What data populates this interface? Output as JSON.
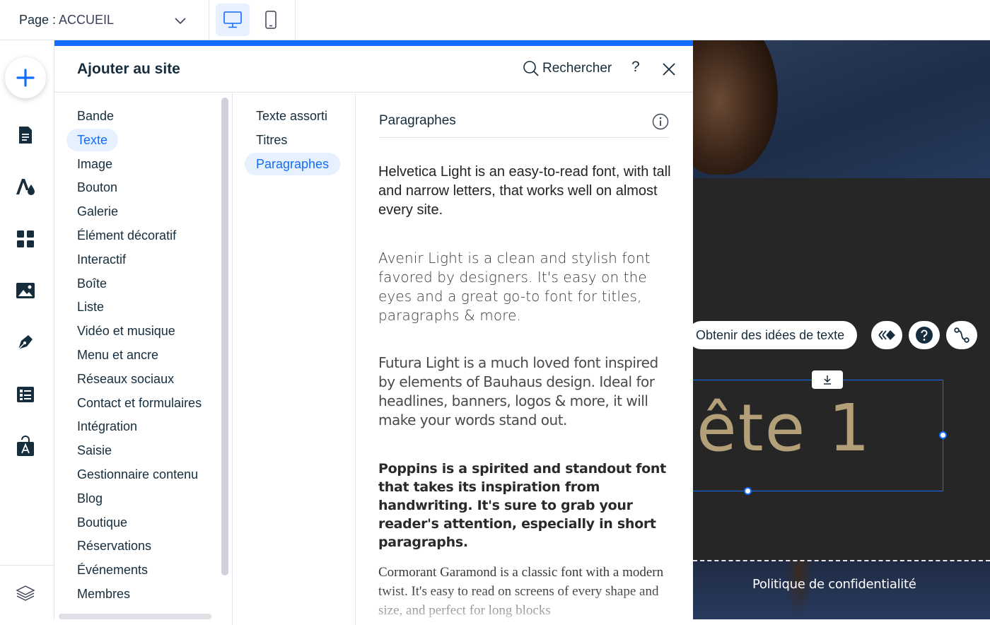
{
  "topbar": {
    "page_label": "Page :",
    "page_name": "ACCUEIL",
    "devices": [
      {
        "name": "desktop",
        "icon": "desktop-icon",
        "active": true
      },
      {
        "name": "mobile",
        "icon": "mobile-icon",
        "active": false
      }
    ]
  },
  "left_toolbar": {
    "add_icon": "plus-icon",
    "tools": [
      "pages-icon",
      "theme-icon",
      "apps-icon",
      "media-icon",
      "pen-icon",
      "cms-icon",
      "app-market-icon"
    ],
    "bottom_tool": "layers-icon"
  },
  "panel": {
    "title": "Ajouter au site",
    "search_label": "Rechercher",
    "help_label": "?",
    "categories": [
      {
        "label": "Bande",
        "active": false
      },
      {
        "label": "Texte",
        "active": true
      },
      {
        "label": "Image",
        "active": false
      },
      {
        "label": "Bouton",
        "active": false
      },
      {
        "label": "Galerie",
        "active": false
      },
      {
        "label": "Élément décoratif",
        "active": false
      },
      {
        "label": "Interactif",
        "active": false
      },
      {
        "label": "Boîte",
        "active": false
      },
      {
        "label": "Liste",
        "active": false
      },
      {
        "label": "Vidéo et musique",
        "active": false
      },
      {
        "label": "Menu et ancre",
        "active": false
      },
      {
        "label": "Réseaux sociaux",
        "active": false
      },
      {
        "label": "Contact et formulaires",
        "active": false
      },
      {
        "label": "Intégration",
        "active": false
      },
      {
        "label": "Saisie",
        "active": false
      },
      {
        "label": "Gestionnaire contenu",
        "active": false
      },
      {
        "label": "Blog",
        "active": false
      },
      {
        "label": "Boutique",
        "active": false
      },
      {
        "label": "Réservations",
        "active": false
      },
      {
        "label": "Événements",
        "active": false
      },
      {
        "label": "Membres",
        "active": false
      }
    ],
    "subcategories": [
      {
        "label": "Texte assorti",
        "active": false
      },
      {
        "label": "Titres",
        "active": false
      },
      {
        "label": "Paragraphes",
        "active": true
      }
    ],
    "section_title": "Paragraphes",
    "samples": [
      "Helvetica Light is an easy-to-read font, with tall and narrow letters, that works well on almost every site.",
      "Avenir Light is a clean and stylish font favored by designers. It's easy on the eyes and a great go-to font for titles, paragraphs & more.",
      "Futura Light is a much loved font inspired by elements of Bauhaus design. Ideal for headlines, banners, logos & more, it will make your words stand out.",
      "Poppins is a spirited and standout font that takes its inspiration from handwriting. It's sure to grab your reader's attention, especially in short paragraphs.",
      "Cormorant Garamond is a classic font with a modern twist. It's easy to read on screens of every shape and size, and perfect for long blocks"
    ]
  },
  "canvas": {
    "ideas_button": "Obtenir des idées de texte",
    "heading_fragment": "ête 1",
    "footer_link": "Politique de confidentialité",
    "colors": {
      "accent": "#116dff",
      "heading": "#b3a078",
      "band": "#262626"
    }
  }
}
